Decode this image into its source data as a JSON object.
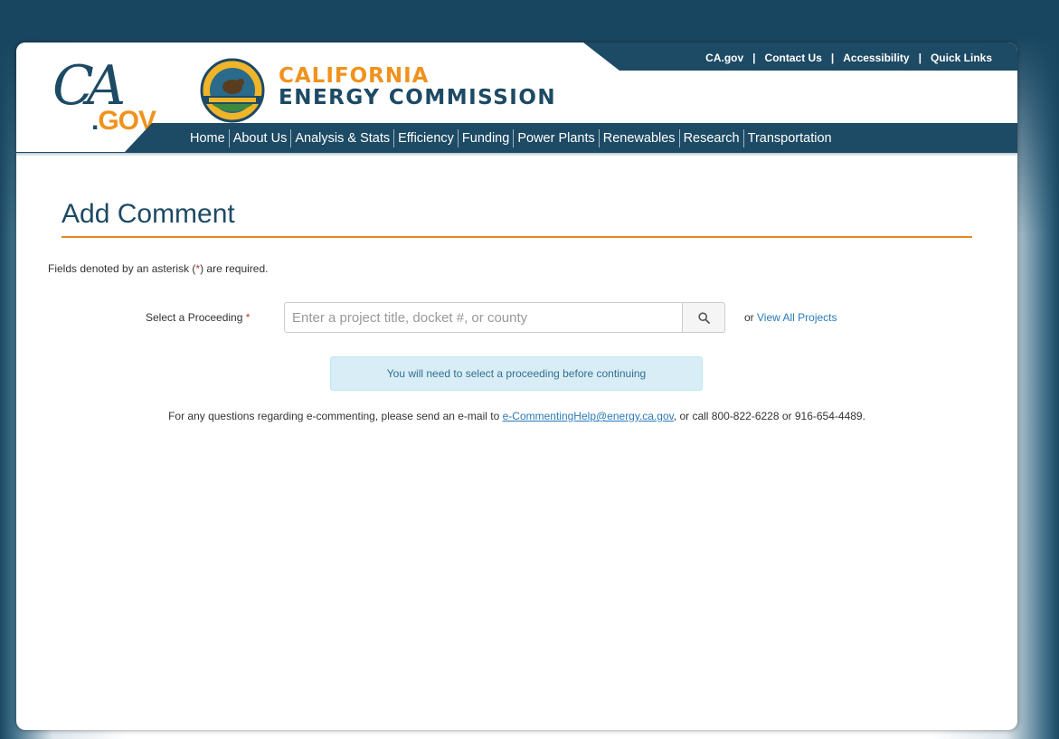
{
  "utility_links": [
    "CA.gov",
    "Contact Us",
    "Accessibility",
    "Quick Links"
  ],
  "logo": {
    "ca_script": "CA",
    "ca_gov": "GOV",
    "ca_gov_dot": "."
  },
  "agency": {
    "line1": "CALIFORNIA",
    "line2": "ENERGY COMMISSION"
  },
  "nav": [
    "Home",
    "About Us",
    "Analysis & Stats",
    "Efficiency",
    "Funding",
    "Power Plants",
    "Renewables",
    "Research",
    "Transportation"
  ],
  "page": {
    "title": "Add Comment",
    "required_note_pre": "Fields denoted by an asterisk (",
    "required_note_ast": "*",
    "required_note_post": ") are required.",
    "proceeding_label": "Select a Proceeding",
    "proceeding_ast": "*",
    "search_placeholder": "Enter a project title, docket #, or county",
    "search_value": "",
    "or": "or ",
    "view_all": "View All Projects",
    "alert": "You will need to select a proceeding before continuing",
    "help_pre": "For any questions regarding e-commenting, please send an e-mail to ",
    "help_email": "e-CommentingHelp@energy.ca.gov",
    "help_post": ", or call 800-822-6228 or 916-654-4489."
  },
  "colors": {
    "brand_navy": "#1d4a64",
    "brand_orange": "#f0921d",
    "link": "#2a7ab8",
    "alert_bg": "#d9edf7"
  }
}
